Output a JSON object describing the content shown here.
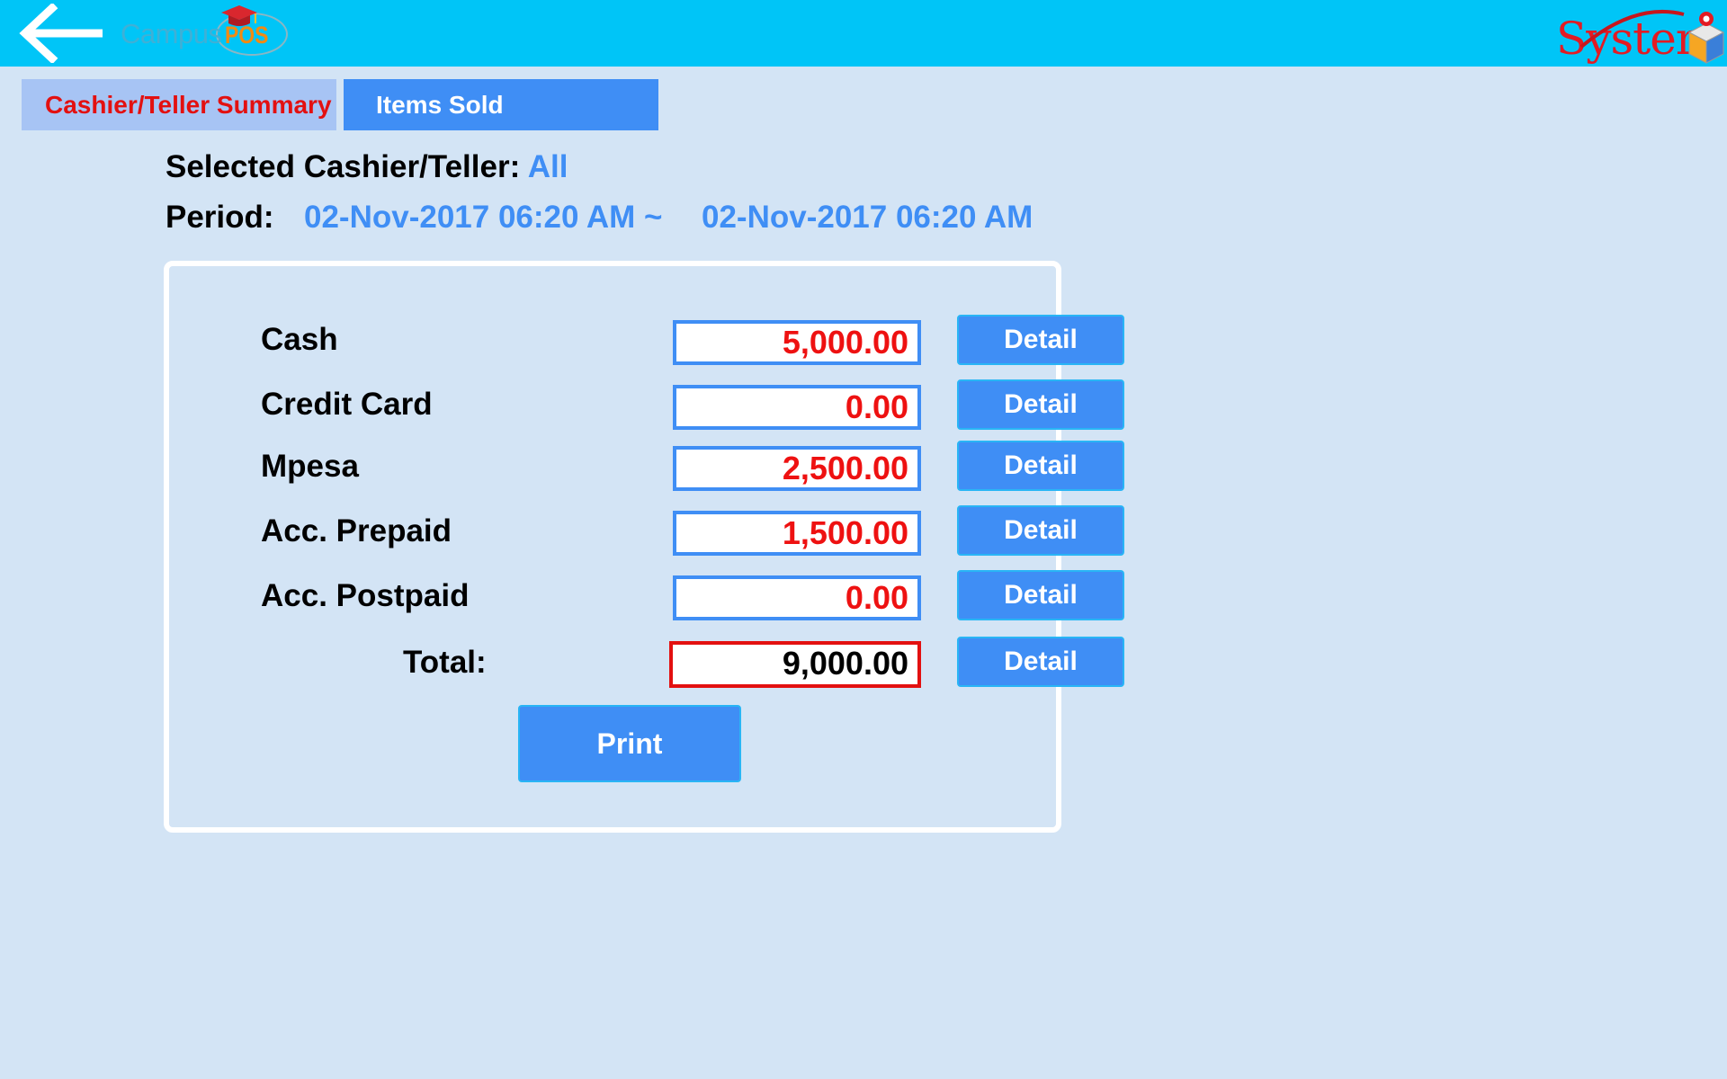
{
  "header": {
    "brand": {
      "campus": "Campus",
      "pos": "POS"
    },
    "system_logo": {
      "text": "System"
    },
    "back_icon": "arrow-left-icon",
    "colors": {
      "bar": "#00c5f7",
      "accent": "#3f8ef5",
      "alert": "#e31010"
    }
  },
  "tabs": [
    {
      "label": "Cashier/Teller Summary",
      "active": true
    },
    {
      "label": "Items Sold",
      "active": false
    }
  ],
  "info": {
    "cashier_label": "Selected Cashier/Teller:",
    "cashier_value": "All",
    "period_label": "Period:",
    "period_start": "02-Nov-2017 06:20 AM ~",
    "period_end": "02-Nov-2017 06:20 AM"
  },
  "summary": {
    "rows": [
      {
        "label": "Cash",
        "amount": "5,000.00",
        "button": "Detail"
      },
      {
        "label": "Credit Card",
        "amount": "0.00",
        "button": "Detail"
      },
      {
        "label": "Mpesa",
        "amount": "2,500.00",
        "button": "Detail"
      },
      {
        "label": "Acc. Prepaid",
        "amount": "1,500.00",
        "button": "Detail"
      },
      {
        "label": "Acc. Postpaid",
        "amount": "0.00",
        "button": "Detail"
      }
    ],
    "total": {
      "label": "Total:",
      "amount": "9,000.00",
      "button": "Detail"
    },
    "print_label": "Print"
  }
}
